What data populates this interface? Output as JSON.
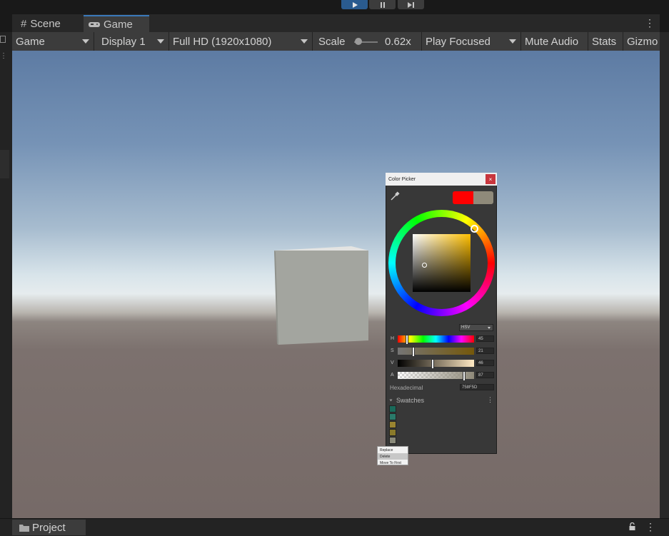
{
  "playmode": {
    "play": "play-icon",
    "pause": "pause-icon",
    "step": "step-icon"
  },
  "tabs": {
    "scene_label": "Scene",
    "game_label": "Game"
  },
  "toolbar": {
    "view_mode": "Game",
    "display": "Display 1",
    "resolution": "Full HD (1920x1080)",
    "scale_label": "Scale",
    "scale_value": "0.62x",
    "play_focus": "Play Focused",
    "mute_audio": "Mute Audio",
    "stats": "Stats",
    "gizmos": "Gizmo"
  },
  "color_picker": {
    "title": "Color Picker",
    "close": "×",
    "mode": "HSV",
    "colors": {
      "current": "#ff0000",
      "previous": "#8f8a7a"
    },
    "sliders": [
      {
        "label": "H",
        "value": "45",
        "fraction": 0.125
      },
      {
        "label": "S",
        "value": "21",
        "fraction": 0.21
      },
      {
        "label": "V",
        "value": "46",
        "fraction": 0.46
      },
      {
        "label": "A",
        "value": "87",
        "fraction": 0.87
      }
    ],
    "hex_label": "Hexadecimal",
    "hex_value": "758F5D",
    "swatches_label": "Swatches",
    "swatch_colors": [
      "#1a6a5a",
      "#2a7a6a",
      "#9a8430",
      "#8a7a2a",
      "#8a8a7a"
    ]
  },
  "context_menu": {
    "items": [
      "Replace",
      "Delete",
      "Move To First"
    ]
  },
  "bottom": {
    "project_label": "Project"
  }
}
